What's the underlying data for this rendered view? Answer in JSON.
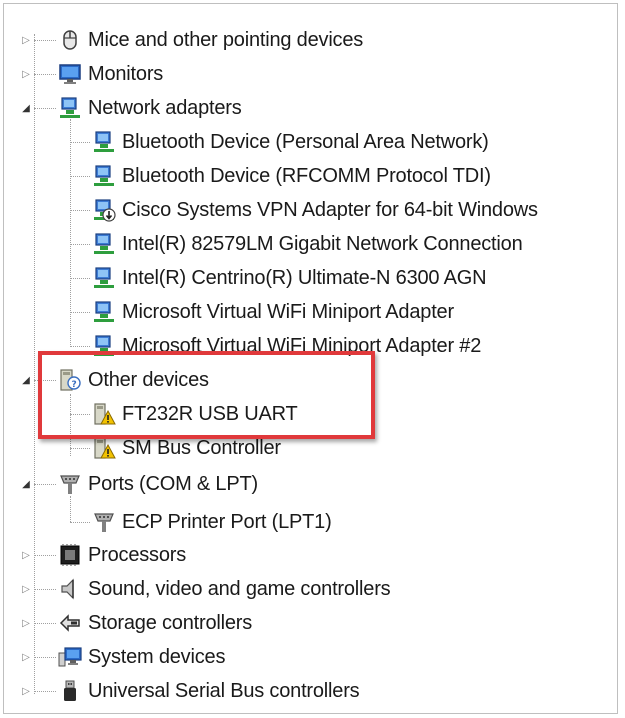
{
  "tree": {
    "categories": [
      {
        "label": "Mice and other pointing devices",
        "icon": "mouse-icon",
        "expanded": false
      },
      {
        "label": "Monitors",
        "icon": "monitor-icon",
        "expanded": false
      },
      {
        "label": "Network adapters",
        "icon": "network-adapter-icon",
        "expanded": true,
        "children": [
          "Bluetooth Device (Personal Area Network)",
          "Bluetooth Device (RFCOMM Protocol TDI)",
          "Cisco Systems VPN Adapter for 64-bit Windows",
          "Intel(R) 82579LM Gigabit Network Connection",
          "Intel(R) Centrino(R) Ultimate-N 6300 AGN",
          "Microsoft Virtual WiFi Miniport Adapter",
          "Microsoft Virtual WiFi Miniport Adapter #2"
        ]
      },
      {
        "label": "Other devices",
        "icon": "unknown-device-icon",
        "expanded": true,
        "children": [
          "FT232R USB UART",
          "SM Bus Controller"
        ]
      },
      {
        "label": "Ports (COM & LPT)",
        "icon": "port-icon",
        "expanded": true,
        "children": [
          "ECP Printer Port (LPT1)"
        ]
      },
      {
        "label": "Processors",
        "icon": "processor-icon",
        "expanded": false
      },
      {
        "label": "Sound, video and game controllers",
        "icon": "speaker-icon",
        "expanded": false
      },
      {
        "label": "Storage controllers",
        "icon": "storage-icon",
        "expanded": false
      },
      {
        "label": "System devices",
        "icon": "system-device-icon",
        "expanded": false
      },
      {
        "label": "Universal Serial Bus controllers",
        "icon": "usb-icon",
        "expanded": false
      }
    ]
  },
  "colors": {
    "highlight_border": "#e0393b",
    "warning_yellow": "#f2c200"
  }
}
